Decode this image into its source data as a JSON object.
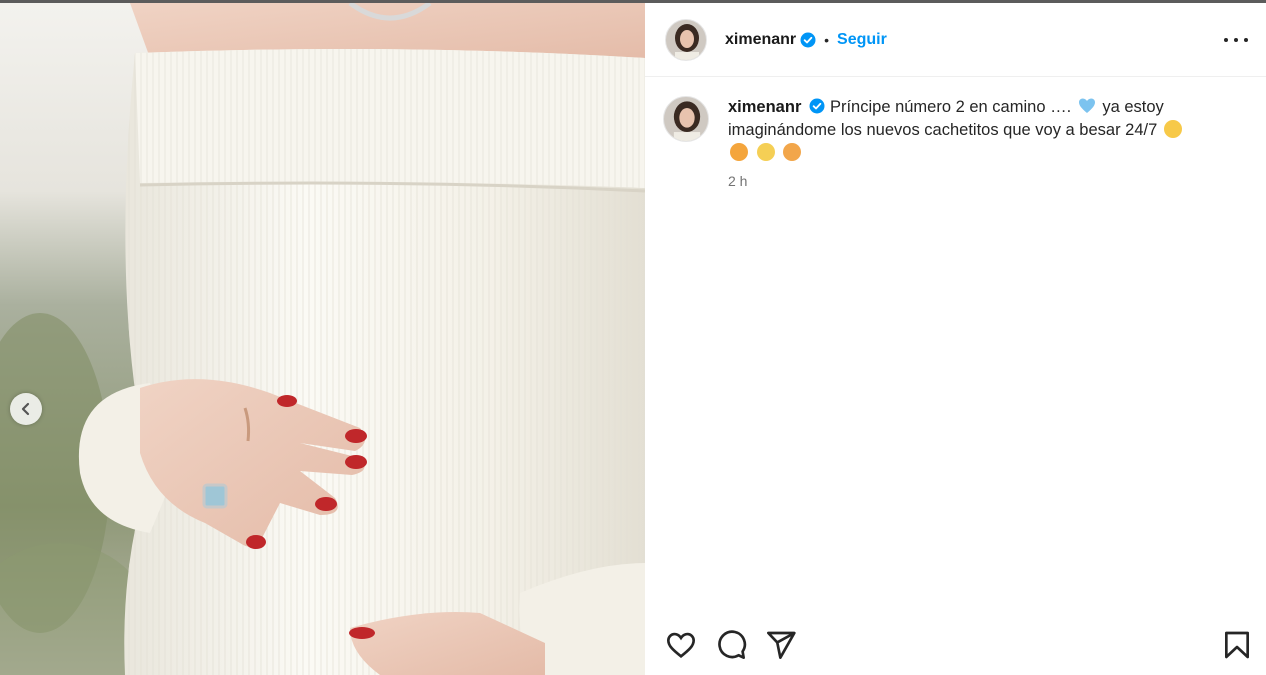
{
  "post": {
    "username": "ximenanr",
    "follow_label": "Seguir",
    "separator": "•",
    "caption_text": "Príncipe número 2 en camino …. ",
    "caption_text_2": " ya estoy imaginándome los nuevos cachetitos que voy a besar 24/7 ",
    "time_ago": "2 h"
  },
  "icons": {
    "verified": "verified-badge-icon",
    "more": "more-options-icon",
    "prev": "chevron-left-icon",
    "like": "heart-icon",
    "comment": "comment-icon",
    "share": "send-icon",
    "save": "bookmark-icon"
  },
  "colors": {
    "accent": "#0095f6",
    "verified": "#0095f6",
    "text": "#262626",
    "muted": "#737373"
  }
}
